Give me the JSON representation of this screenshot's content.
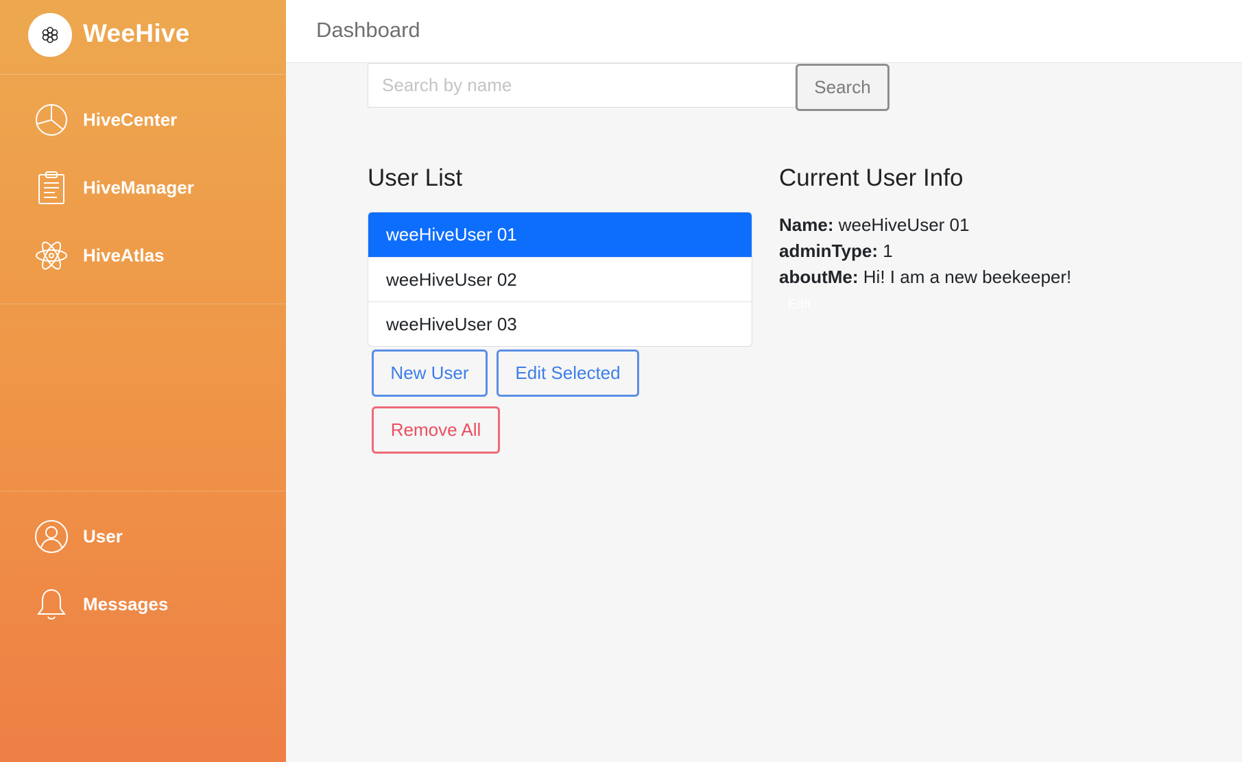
{
  "brand": {
    "name": "WeeHive",
    "logo_icon": "flower-icon"
  },
  "sidebar": {
    "items": [
      {
        "label": "HiveCenter",
        "icon": "pie-chart-icon"
      },
      {
        "label": "HiveManager",
        "icon": "clipboard-icon"
      },
      {
        "label": "HiveAtlas",
        "icon": "atom-icon"
      }
    ],
    "bottom_items": [
      {
        "label": "User",
        "icon": "user-circle-icon"
      },
      {
        "label": "Messages",
        "icon": "bell-icon"
      }
    ]
  },
  "header": {
    "title": "Dashboard"
  },
  "search": {
    "placeholder": "Search by name",
    "value": "",
    "button_label": "Search"
  },
  "user_list": {
    "heading": "User List",
    "items": [
      "weeHiveUser 01",
      "weeHiveUser 02",
      "weeHiveUser 03"
    ],
    "selected_index": 0,
    "new_label": "New User",
    "edit_label": "Edit Selected",
    "remove_label": "Remove All"
  },
  "current_user": {
    "heading": "Current User Info",
    "name_label": "Name:",
    "name": "weeHiveUser 01",
    "admin_label": "adminType:",
    "admin_type": "1",
    "about_label": "aboutMe:",
    "about": "Hi! I am a new beekeeper!",
    "edit_label": "Edit"
  },
  "colors": {
    "sidebar_top": "#eda84f",
    "sidebar_bottom": "#ee7f45",
    "selected": "#0d6efd",
    "primary_outline": "#5b8ee6",
    "danger_outline": "#ee6a78"
  }
}
